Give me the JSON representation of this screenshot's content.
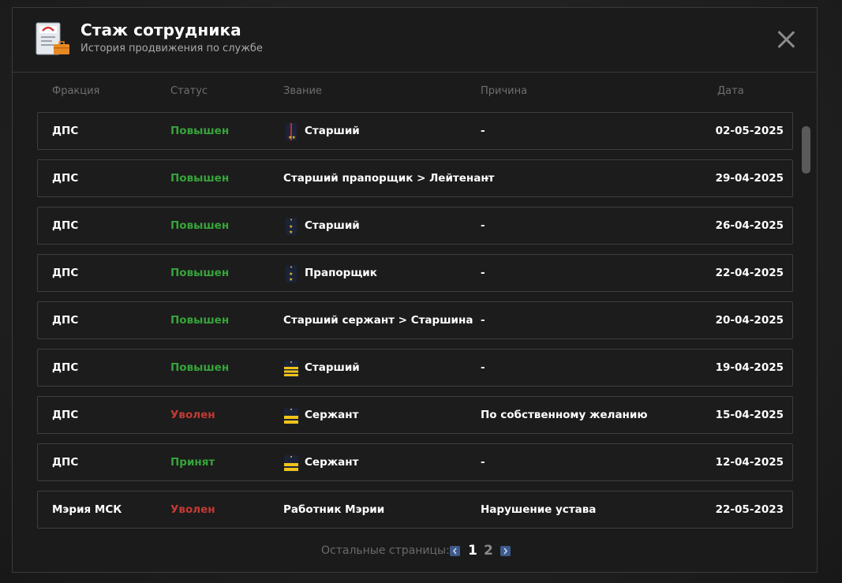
{
  "header": {
    "title": "Стаж сотрудника",
    "subtitle": "История продвижения по службе"
  },
  "columns": {
    "faction": "Фракция",
    "status": "Статус",
    "rank": "Звание",
    "reason": "Причина",
    "date": "Дата"
  },
  "colors": {
    "promoted": "#36a43a",
    "fired": "#c23a35",
    "hired": "#36a43a",
    "accent": "#3d5a8c"
  },
  "rows": [
    {
      "faction": "ДПС",
      "status": "Повышен",
      "status_type": "promoted",
      "rank_icon": "shoulder-strap-officer-stripe",
      "rank": "Старший",
      "reason": "-",
      "date": "02-05-2025"
    },
    {
      "faction": "ДПС",
      "status": "Повышен",
      "status_type": "promoted",
      "rank_icon": "",
      "rank": "Старший прапорщик > Лейтенант",
      "reason": "-",
      "date": "29-04-2025"
    },
    {
      "faction": "ДПС",
      "status": "Повышен",
      "status_type": "promoted",
      "rank_icon": "shoulder-strap-two-stars",
      "rank": "Старший",
      "reason": "-",
      "date": "26-04-2025"
    },
    {
      "faction": "ДПС",
      "status": "Повышен",
      "status_type": "promoted",
      "rank_icon": "shoulder-strap-two-stars",
      "rank": "Прапорщик",
      "reason": "-",
      "date": "22-04-2025"
    },
    {
      "faction": "ДПС",
      "status": "Повышен",
      "status_type": "promoted",
      "rank_icon": "",
      "rank": "Старший сержант > Старшина",
      "reason": "-",
      "date": "20-04-2025"
    },
    {
      "faction": "ДПС",
      "status": "Повышен",
      "status_type": "promoted",
      "rank_icon": "shoulder-strap-three-stripes",
      "rank": "Старший",
      "reason": "-",
      "date": "19-04-2025"
    },
    {
      "faction": "ДПС",
      "status": "Уволен",
      "status_type": "fired",
      "rank_icon": "shoulder-strap-two-stripes",
      "rank": "Сержант",
      "reason": "По собственному желанию",
      "date": "15-04-2025"
    },
    {
      "faction": "ДПС",
      "status": "Принят",
      "status_type": "hired",
      "rank_icon": "shoulder-strap-two-stripes",
      "rank": "Сержант",
      "reason": "-",
      "date": "12-04-2025"
    },
    {
      "faction": "Мэрия МСК",
      "status": "Уволен",
      "status_type": "fired",
      "rank_icon": "",
      "rank": "Работник Мэрии",
      "reason": "Нарушение устава",
      "date": "22-05-2023"
    }
  ],
  "pager": {
    "label": "Остальные страницы:",
    "pages": [
      "1",
      "2"
    ],
    "current": "1",
    "prev_icon": "chevron-left-icon",
    "next_icon": "chevron-right-icon"
  }
}
